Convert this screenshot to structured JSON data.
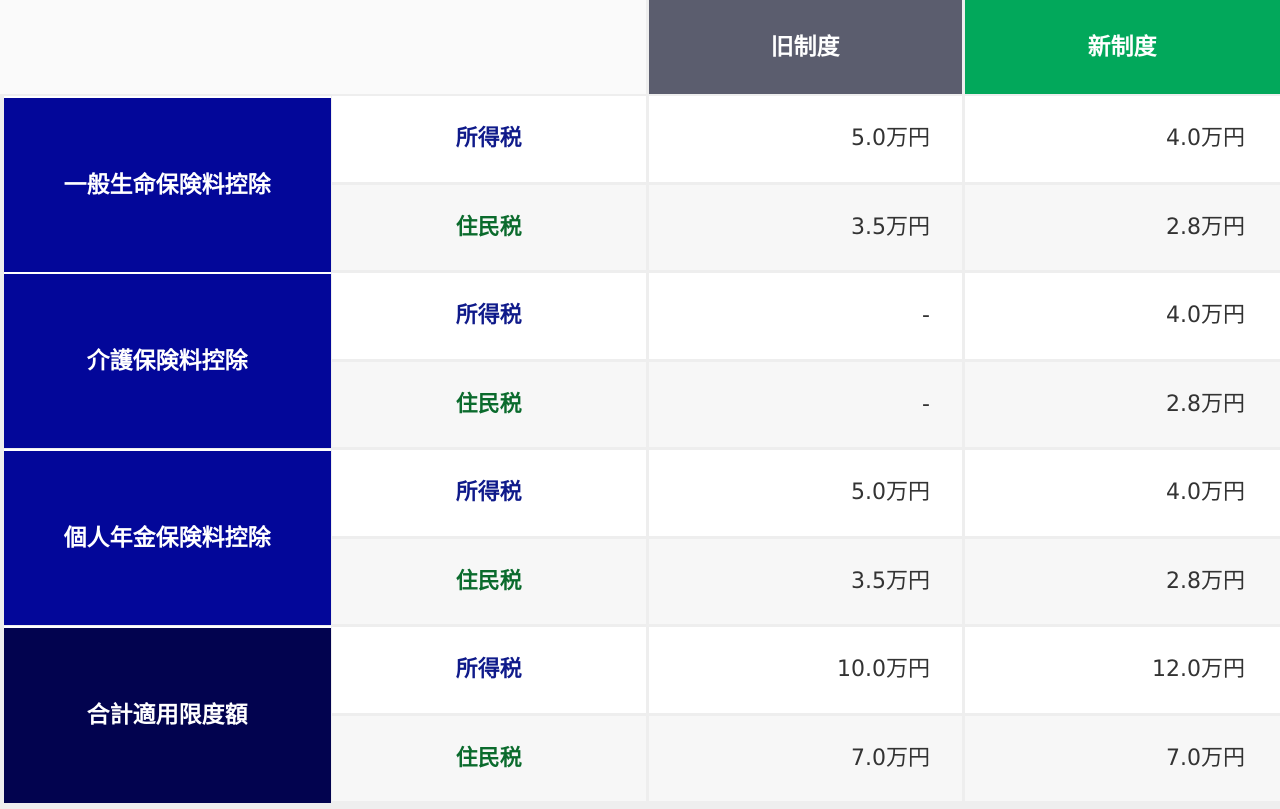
{
  "header": {
    "old_system": "旧制度",
    "new_system": "新制度"
  },
  "rows": [
    {
      "category": "一般生命保険料控除",
      "income_label": "所得税",
      "income_old": "5.0万円",
      "income_new": "4.0万円",
      "resident_label": "住民税",
      "resident_old": "3.5万円",
      "resident_new": "2.8万円"
    },
    {
      "category": "介護保険料控除",
      "income_label": "所得税",
      "income_old": "-",
      "income_new": "4.0万円",
      "resident_label": "住民税",
      "resident_old": "-",
      "resident_new": "2.8万円"
    },
    {
      "category": "個人年金保険料控除",
      "income_label": "所得税",
      "income_old": "5.0万円",
      "income_new": "4.0万円",
      "resident_label": "住民税",
      "resident_old": "3.5万円",
      "resident_new": "2.8万円"
    },
    {
      "category": "合計適用限度額",
      "income_label": "所得税",
      "income_old": "10.0万円",
      "income_new": "12.0万円",
      "resident_label": "住民税",
      "resident_old": "7.0万円",
      "resident_new": "7.0万円"
    }
  ],
  "colors": {
    "header_old": "#5b5d6e",
    "header_new": "#02a85b",
    "category_blue": "#030799",
    "category_total": "#02034f",
    "income_text": "#0f1a8a",
    "resident_text": "#0b6b2d"
  }
}
